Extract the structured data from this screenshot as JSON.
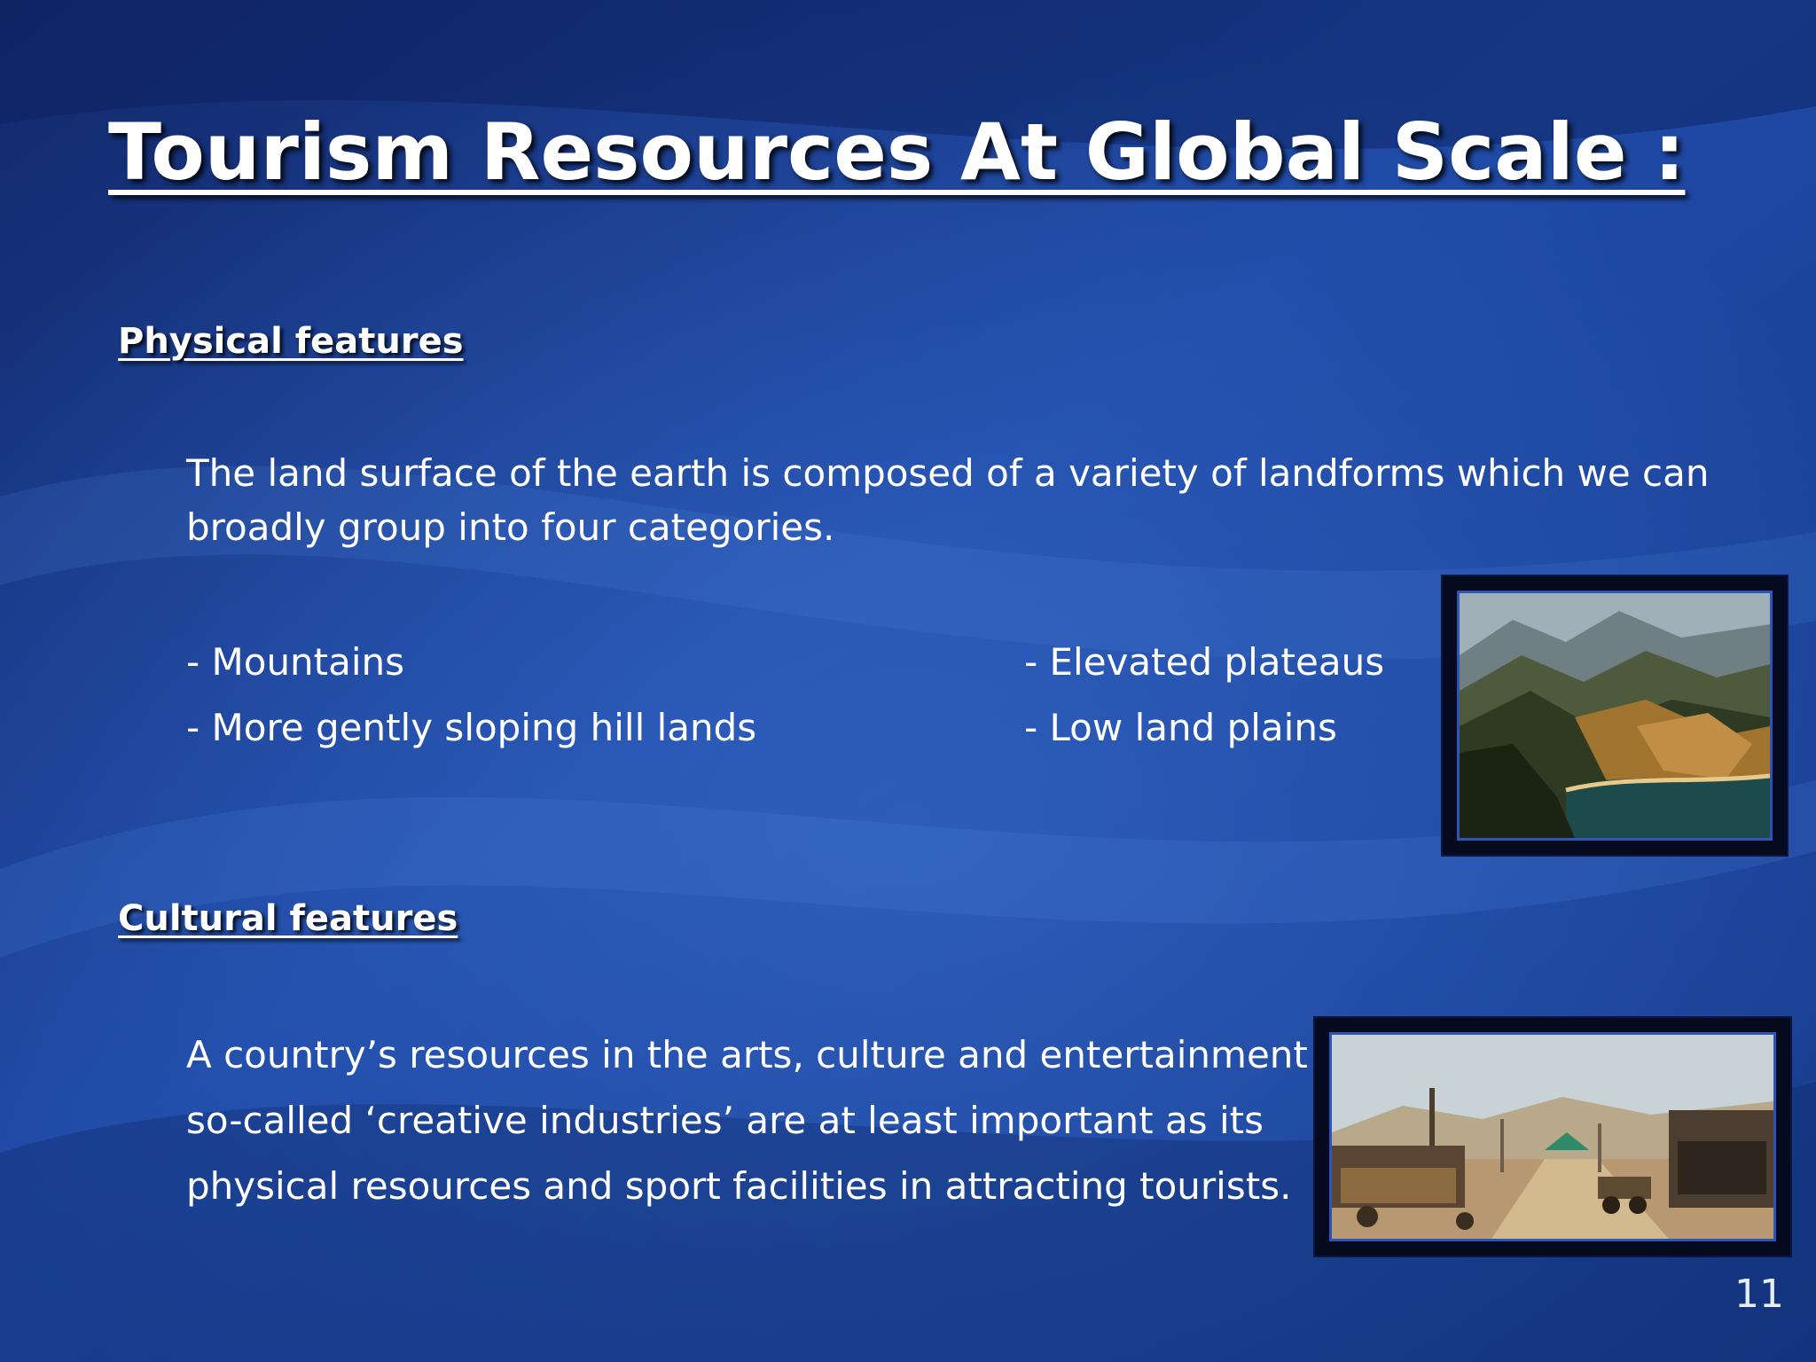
{
  "slide": {
    "title": "Tourism Resources At Global Scale :",
    "page_number": "11"
  },
  "physical": {
    "heading": "Physical features",
    "paragraph": "The land surface of the earth is composed of a variety of landforms which we can broadly group into four categories.",
    "landforms_left": [
      "- Mountains",
      "- More gently sloping hill lands"
    ],
    "landforms_right": [
      "- Elevated plateaus",
      "- Low land plains"
    ]
  },
  "cultural": {
    "heading": "Cultural features",
    "paragraph": "A country’s resources in the arts, culture and entertainment so-called ‘creative industries’ are at least important as its physical resources and sport facilities in attracting tourists."
  },
  "colors": {
    "background": "#1b3f8f",
    "frame": "#050a1f",
    "frame_border": "#2d55b8"
  }
}
